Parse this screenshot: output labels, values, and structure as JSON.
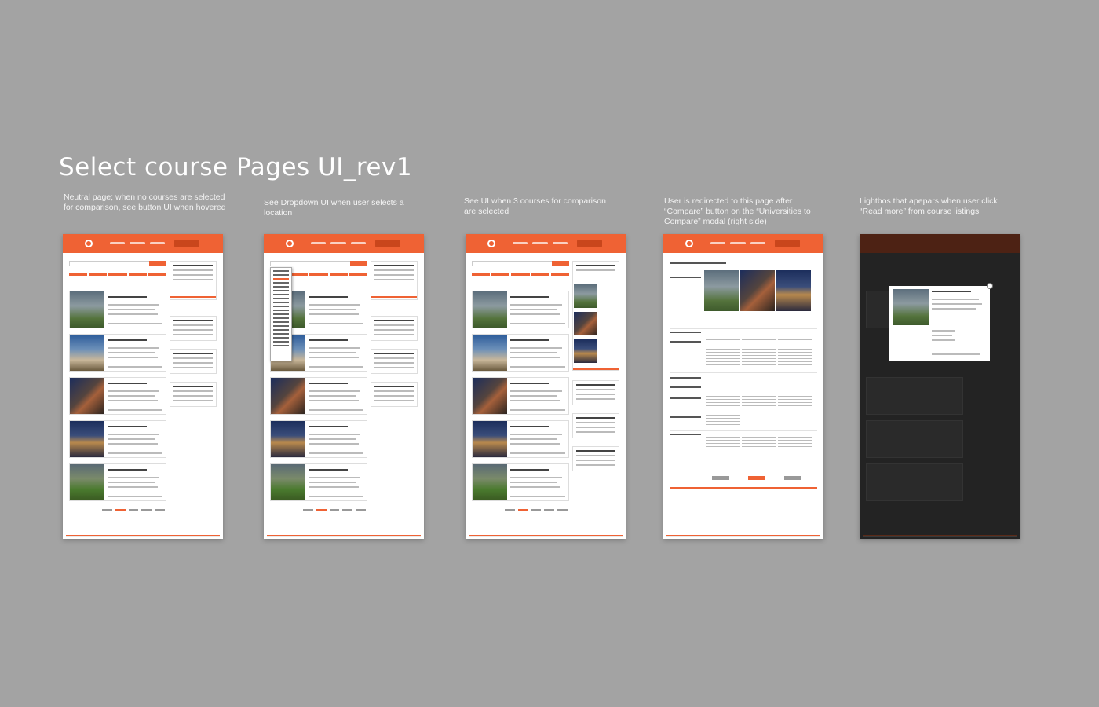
{
  "title": "Select course Pages UI_rev1",
  "captions": [
    "Neutral page; when no courses are selected for comparison, see button UI when hovered",
    "See Dropdown UI when user selects a location",
    "See UI when 3 courses for comparison are selected",
    "User is redirected to this page after “Compare” button on the “Universities to Compare” modal  (right side)",
    "Lightbos that apepars when user click “Read more” from course listings"
  ],
  "colors": {
    "background": "#a3a3a3",
    "accent": "#ef6234"
  }
}
